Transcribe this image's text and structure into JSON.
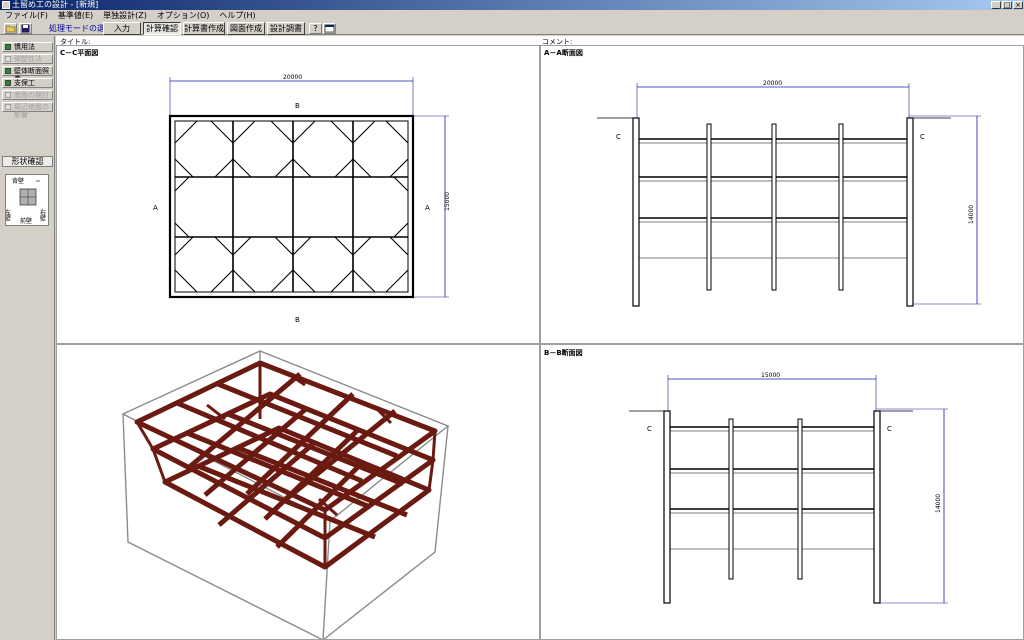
{
  "window": {
    "title": "土留め工の設計 - [新規]",
    "controls": [
      "_",
      "□",
      "×"
    ]
  },
  "menu": [
    "ファイル(F)",
    "基準値(E)",
    "単独設計(Z)",
    "オプション(O)",
    "ヘルプ(H)"
  ],
  "toolbar": {
    "mode_label": "処理モードの選択",
    "modes": [
      "入力",
      "計算確認",
      "計算書作成",
      "図面作成",
      "設計調書"
    ],
    "active_mode": "計算確認"
  },
  "sidebar": {
    "items": [
      {
        "label": "慣用法",
        "enabled": true,
        "led": "#2a8a2a"
      },
      {
        "label": "弾塑性法",
        "enabled": false,
        "led": ""
      },
      {
        "label": "壁体断面照査",
        "enabled": true,
        "led": "#2a8a2a"
      },
      {
        "label": "支保工",
        "enabled": true,
        "led": "#2a8a2a"
      },
      {
        "label": "底版の検討",
        "enabled": false,
        "led": ""
      },
      {
        "label": "周辺地盤の影響",
        "enabled": false,
        "led": ""
      }
    ],
    "shape_tab": "形状確認",
    "shape_labels": {
      "back": "背壁",
      "left": "左壁",
      "right": "右壁",
      "front": "前壁"
    }
  },
  "header": {
    "title_label": "タイトル:",
    "comment_label": "コメント:"
  },
  "views": {
    "plan": {
      "title": "C－C平面図",
      "dim_width": "20000",
      "dim_height": "15000",
      "section_a": "A",
      "section_b": "B"
    },
    "section_aa": {
      "title": "A－A断面図",
      "dim_width": "20000",
      "dim_height": "14000",
      "marker": "C"
    },
    "section_bb": {
      "title": "B－B断面図",
      "dim_width": "15000",
      "dim_height": "14000",
      "marker": "C"
    }
  },
  "colors": {
    "strut": "#6b1a12",
    "dimension": "#1a1ab0",
    "active_led": "#2a8a2a"
  }
}
